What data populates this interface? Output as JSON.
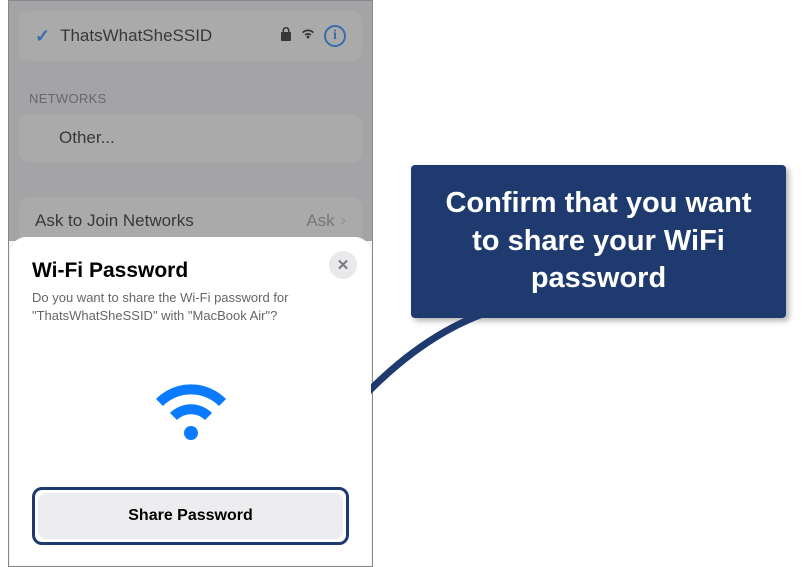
{
  "connected_network": {
    "name": "ThatsWhatSheSSID"
  },
  "sections": {
    "networks_header": "NETWORKS",
    "other_label": "Other...",
    "ask_to_join_label": "Ask to Join Networks",
    "ask_to_join_value": "Ask"
  },
  "share_sheet": {
    "title": "Wi-Fi Password",
    "subtitle": "Do you want to share the Wi-Fi password for \"ThatsWhatSheSSID\" with \"MacBook Air\"?",
    "button_label": "Share Password"
  },
  "callout": {
    "text": "Confirm that you want to share your WiFi password"
  },
  "colors": {
    "accent": "#007aff",
    "callout_bg": "#1e3a6e"
  }
}
